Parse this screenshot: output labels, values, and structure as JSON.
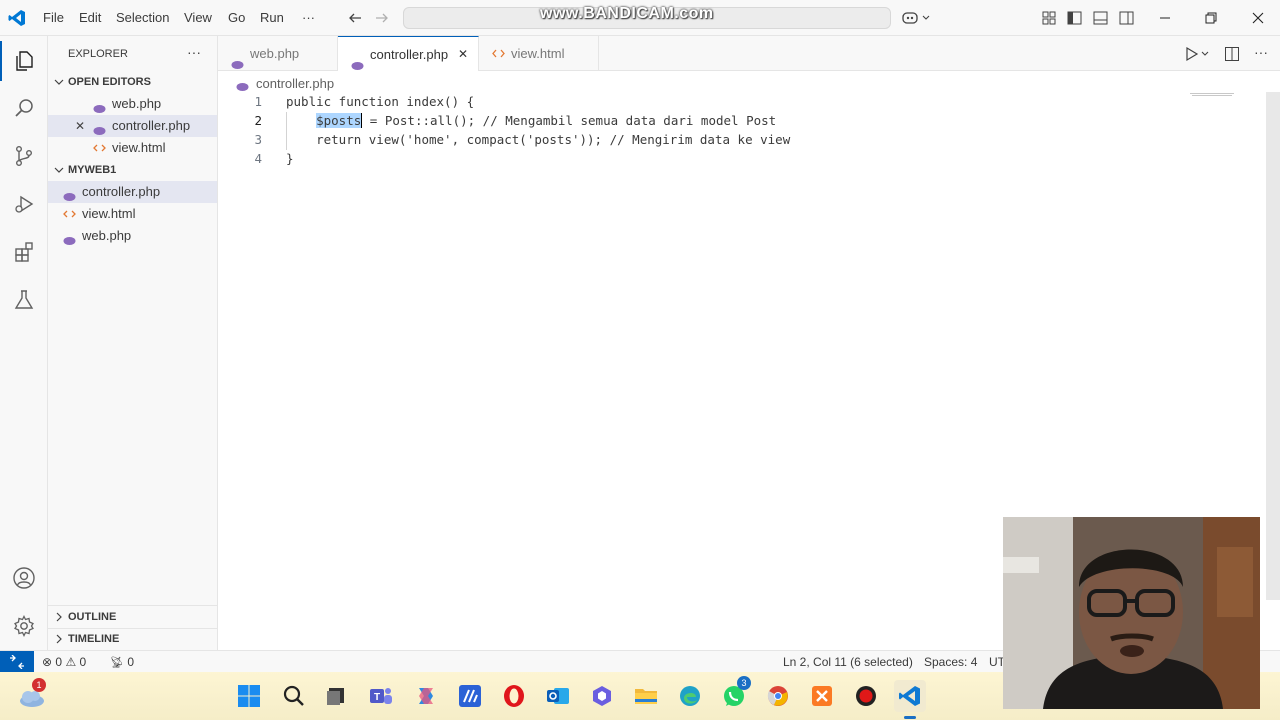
{
  "titlebar": {
    "menu": [
      "File",
      "Edit",
      "Selection",
      "View",
      "Go",
      "Run",
      "···"
    ],
    "watermark": "www.BANDICAM.com"
  },
  "sidebar": {
    "title": "EXPLORER",
    "more": "···",
    "open_editors_label": "OPEN EDITORS",
    "open_editors": [
      {
        "name": "web.php",
        "type": "php"
      },
      {
        "name": "controller.php",
        "type": "php",
        "close": "✕"
      },
      {
        "name": "view.html",
        "type": "html"
      }
    ],
    "folder_label": "MYWEB1",
    "files": [
      {
        "name": "controller.php",
        "type": "php"
      },
      {
        "name": "view.html",
        "type": "html"
      },
      {
        "name": "web.php",
        "type": "php"
      }
    ],
    "outline_label": "OUTLINE",
    "timeline_label": "TIMELINE"
  },
  "tabs": [
    {
      "label": "web.php",
      "type": "php"
    },
    {
      "label": "controller.php",
      "type": "php",
      "close": "✕"
    },
    {
      "label": "view.html",
      "type": "html"
    }
  ],
  "breadcrumb": "controller.php",
  "editor": {
    "lines": [
      {
        "n": "1",
        "text": "public function index() {"
      },
      {
        "n": "2",
        "indent": "    ",
        "selected": "$posts",
        "rest": " = Post::all(); // Mengambil semua data dari model Post"
      },
      {
        "n": "3",
        "text": "    return view('home', compact('posts')); // Mengirim data ke view"
      },
      {
        "n": "4",
        "text": "}"
      }
    ]
  },
  "statusbar": {
    "errors": "0",
    "warnings": "0",
    "ports": "0",
    "position": "Ln 2, Col 11 (6 selected)",
    "spaces": "Spaces: 4",
    "encoding": "UT"
  },
  "taskbar": {
    "weather_badge": "1",
    "whatsapp_badge": "3"
  },
  "colors": {
    "accent": "#005fb8",
    "php_icon": "#8c6bbd",
    "html_icon": "#e37933",
    "selection": "#add6ff"
  }
}
